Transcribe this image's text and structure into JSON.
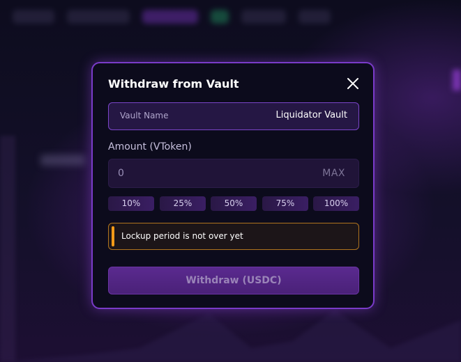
{
  "modal": {
    "title": "Withdraw from Vault",
    "vault_name_label": "Vault Name",
    "vault_name_value": "Liquidator Vault",
    "amount_label": "Amount (VToken)",
    "amount_value": "0",
    "max_label": "MAX",
    "percent_options": [
      "10%",
      "25%",
      "50%",
      "75%",
      "100%"
    ],
    "warning_text": "Lockup period is not over yet",
    "submit_label": "Withdraw (USDC)"
  },
  "colors": {
    "accent": "#7a3bc9",
    "warning": "#f29a18",
    "background": "#0c0b1c"
  }
}
